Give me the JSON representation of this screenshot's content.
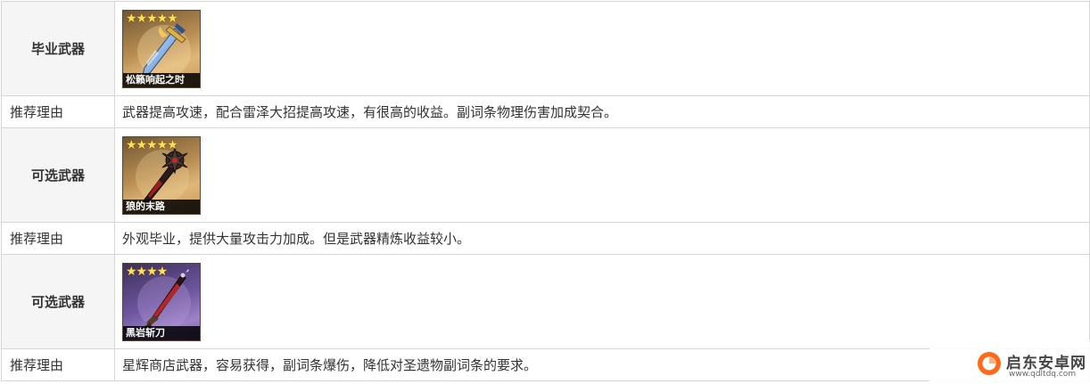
{
  "rows": [
    {
      "type": "weapon",
      "label": "毕业武器",
      "weapon": {
        "name": "松籁响起之时",
        "stars": "★★★★★",
        "rarity": 5,
        "background": "gold",
        "icon": "greatsword-blue-icon"
      }
    },
    {
      "type": "reason",
      "label": "推荐理由",
      "text": "武器提高攻速，配合雷泽大招提高攻速，有很高的收益。副词条物理伤害加成契合。"
    },
    {
      "type": "weapon",
      "label": "可选武器",
      "weapon": {
        "name": "狼的末路",
        "stars": "★★★★★",
        "rarity": 5,
        "background": "gold",
        "icon": "greatsword-dark-red-icon"
      }
    },
    {
      "type": "reason",
      "label": "推荐理由",
      "text": "外观毕业，提供大量攻击力加成。但是武器精炼收益较小。"
    },
    {
      "type": "weapon",
      "label": "可选武器",
      "weapon": {
        "name": "黑岩斩刀",
        "stars": "★★★★",
        "rarity": 4,
        "background": "purple",
        "icon": "greatsword-red-black-icon"
      }
    },
    {
      "type": "reason",
      "label": "推荐理由",
      "text": "星辉商店武器，容易获得，副词条爆伤，降低对圣遗物副词条的要求。"
    }
  ],
  "watermark": {
    "brand": "启东安卓网",
    "url": "www.qdltdq.com",
    "color": "#ff6a1a"
  }
}
